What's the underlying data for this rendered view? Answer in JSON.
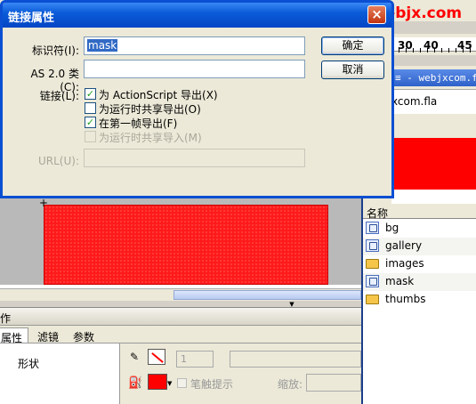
{
  "dialog": {
    "title": "链接属性",
    "identifier_label": "标识符(I):",
    "identifier_value": "mask",
    "as2_class_label": "AS 2.0 类(C):",
    "as2_class_value": "",
    "linkage_label": "链接(L):",
    "options": [
      {
        "label": "为 ActionScript 导出(X)",
        "checked": true,
        "enabled": true
      },
      {
        "label": "为运行时共享导出(O)",
        "checked": false,
        "enabled": true
      },
      {
        "label": "在第一帧导出(F)",
        "checked": true,
        "enabled": true
      },
      {
        "label": "为运行时共享导入(M)",
        "checked": false,
        "enabled": false
      }
    ],
    "url_label": "URL(U):",
    "url_value": "",
    "ok_label": "确定",
    "cancel_label": "取消",
    "close_glyph": "×",
    "check_glyph": "✓"
  },
  "background": {
    "watermark": "webjx.com",
    "ruler_numbers": [
      "30",
      "40",
      "45"
    ],
    "doc_title": "≡ - webjxcom.fla",
    "doc_file": "xcom.fla",
    "library_header": "名称",
    "library_items": [
      {
        "name": "bg",
        "type": "symbol"
      },
      {
        "name": "gallery",
        "type": "symbol"
      },
      {
        "name": "images",
        "type": "folder"
      },
      {
        "name": "mask",
        "type": "symbol"
      },
      {
        "name": "thumbs",
        "type": "folder"
      }
    ],
    "actions_label": "动作",
    "tabs": [
      "属性",
      "滤镜",
      "参数"
    ],
    "shape_label": "形状",
    "stroke_width": "1",
    "hint_label": "笔触提示",
    "zoom_label": "缩放:",
    "stroke_color": "#ff0000",
    "fill_color": "#ff0000"
  }
}
